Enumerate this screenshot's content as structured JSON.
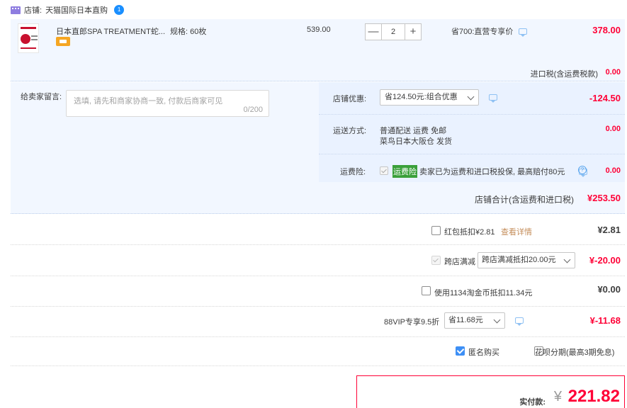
{
  "shop": {
    "prefix": "店铺:",
    "name": "天猫国际日本直购",
    "badge": "1"
  },
  "item": {
    "title": "日本直郎SPA TREATMENT蛇...",
    "spec": "规格: 60枚",
    "unit_price": "539.00",
    "quantity": "2",
    "minus": "—",
    "plus": "+",
    "promo": "省700:直营专享价",
    "subtotal": "378.00",
    "tax_label": "进口税(含运费税款)",
    "tax_value": "0.00"
  },
  "message": {
    "label": "给卖家留言:",
    "placeholder": "选填, 请先和商家协商一致, 付款后商家可见",
    "count": "0/200"
  },
  "shop_coupon": {
    "label": "店铺优惠:",
    "selected": "省124.50元:组合优惠",
    "value": "-124.50"
  },
  "shipping": {
    "label": "运送方式:",
    "line1": "普通配送 运费 免邮",
    "line2": "菜鸟日本大阪仓   发货",
    "value": "0.00"
  },
  "insurance": {
    "label": "运费险:",
    "highlight": "运费险",
    "text": "卖家已为运费和进口税投保, 最高赔付80元",
    "value": "0.00"
  },
  "shop_total": {
    "label": "店铺合计(含运费和进口税)",
    "value": "¥253.50"
  },
  "summary": {
    "redpacket": {
      "label": "红包抵扣¥2.81",
      "link": "查看详情",
      "value": "¥2.81"
    },
    "crossstore": {
      "label": "跨店满减",
      "selected": "跨店满减抵扣20.00元",
      "value": "¥-20.00"
    },
    "taojinbi": {
      "label": "使用1134淘金币抵扣11.34元",
      "value": "¥0.00"
    },
    "vip": {
      "label": "88VIP专享9.5折",
      "selected": "省11.68元",
      "value": "¥-11.68"
    },
    "anonymous": {
      "label": "匿名购买",
      "checked": true
    },
    "huabei": {
      "label": "花呗分期(最高3期免息)",
      "checked": false
    }
  },
  "pay": {
    "label": "实付款:",
    "currency": "¥",
    "amount": "221.82"
  }
}
